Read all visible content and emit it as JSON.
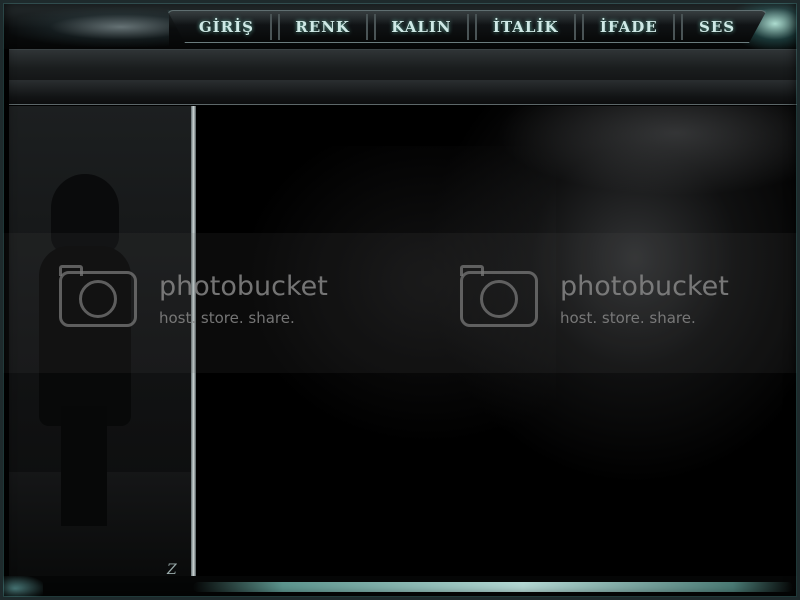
{
  "nav": {
    "items": [
      {
        "label": "GİRİŞ"
      },
      {
        "label": "RENK"
      },
      {
        "label": "KALIN"
      },
      {
        "label": "İTALİK"
      },
      {
        "label": "İFADE"
      },
      {
        "label": "SES"
      }
    ]
  },
  "watermark": {
    "brand": "photobucket",
    "tagline": "host. store. share."
  },
  "signature": {
    "text": "Z"
  },
  "colors": {
    "accent": "#8ee6dc",
    "frame": "#1e2a2c",
    "panel": "#121314"
  },
  "icons": {
    "watermark": "camera-icon"
  }
}
